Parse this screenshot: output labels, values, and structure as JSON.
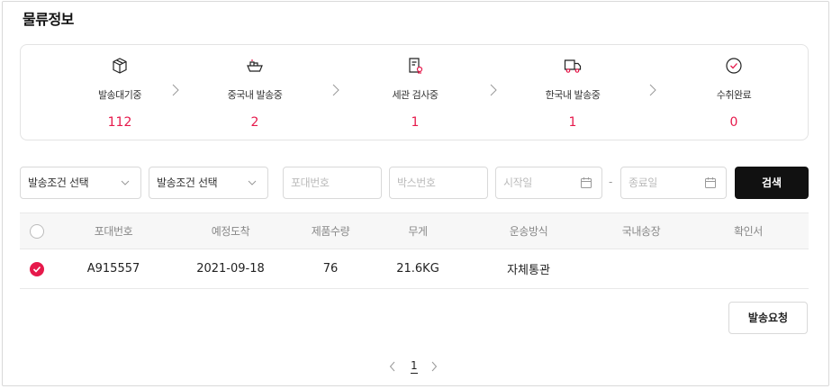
{
  "page": {
    "title": "물류정보"
  },
  "steps": [
    {
      "label": "발송대기중",
      "count": "112",
      "icon": "box-icon"
    },
    {
      "label": "중국내 발송중",
      "count": "2",
      "icon": "cargo-ship-icon"
    },
    {
      "label": "세관 검사중",
      "count": "1",
      "icon": "customs-document-icon"
    },
    {
      "label": "한국내 발송중",
      "count": "1",
      "icon": "delivery-truck-icon"
    },
    {
      "label": "수취완료",
      "count": "0",
      "icon": "check-circle-icon"
    }
  ],
  "filters": {
    "condition1": "발송조건 선택",
    "condition2": "발송조건 선택",
    "bag_no_placeholder": "포대번호",
    "box_no_placeholder": "박스번호",
    "start_placeholder": "시작일",
    "range_sep": "-",
    "end_placeholder": "종료일",
    "search_label": "검색"
  },
  "table": {
    "headers": [
      "포대번호",
      "예정도착",
      "제품수량",
      "무게",
      "운송방식",
      "국내송장",
      "확인서"
    ],
    "rows": [
      {
        "selected": true,
        "cells": [
          "A915557",
          "2021-09-18",
          "76",
          "21.6KG",
          "자체통관",
          "",
          ""
        ]
      }
    ]
  },
  "actions": {
    "request_label": "발송요청"
  },
  "pagination": {
    "current": "1"
  },
  "colors": {
    "accent": "#e6194b",
    "button_dark": "#111111"
  }
}
